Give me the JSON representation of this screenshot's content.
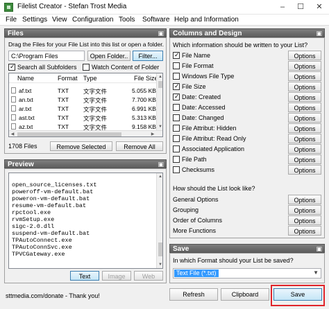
{
  "window": {
    "title": "Filelist Creator - Stefan Trost Media",
    "controls": {
      "minimize": "–",
      "maximize": "☐",
      "close": "✕"
    }
  },
  "menu": [
    "File",
    "Settings",
    "View",
    "Configuration",
    "Tools",
    "Software",
    "Help and Information"
  ],
  "files_panel": {
    "title": "Files",
    "instruction": "Drag the Files for your File List into this list or open a folder.",
    "path_value": "C:\\Program Files",
    "open_folder_label": "Open Folder..",
    "filter_label": "Filter...",
    "search_subfolders_label": "Search all Subfolders",
    "search_subfolders_checked": true,
    "watch_content_label": "Watch Content of Folder",
    "watch_content_checked": false,
    "columns": [
      "Name",
      "Format",
      "Type",
      "File Size"
    ],
    "rows": [
      [
        "af.txt",
        "TXT",
        "文字文件",
        "5.055 KB"
      ],
      [
        "an.txt",
        "TXT",
        "文字文件",
        "7.700 KB"
      ],
      [
        "ar.txt",
        "TXT",
        "文字文件",
        "6.991 KB"
      ],
      [
        "ast.txt",
        "TXT",
        "文字文件",
        "5.313 KB"
      ],
      [
        "az.txt",
        "TXT",
        "文字文件",
        "9.158 KB"
      ]
    ],
    "count_label": "1708 Files",
    "remove_selected_label": "Remove Selected",
    "remove_all_label": "Remove All"
  },
  "preview_panel": {
    "title": "Preview",
    "lines": [
      "open_source_licenses.txt",
      "poweroff-vm-default.bat",
      "poweron-vm-default.bat",
      "resume-vm-default.bat",
      "rpctool.exe",
      "rvmSetup.exe",
      "sigc-2.0.dll",
      "suspend-vm-default.bat",
      "TPAutoConnect.exe",
      "TPAutoConnSvc.exe",
      "TPVCGateway.exe"
    ],
    "text_label": "Text",
    "image_label": "Image",
    "web_label": "Web"
  },
  "columns_panel": {
    "title": "Columns and Design",
    "question": "Which information should be written to your List?",
    "option_label": "Options",
    "items": [
      {
        "label": "File Name",
        "checked": true
      },
      {
        "label": "File Format",
        "checked": false
      },
      {
        "label": "Windows File Type",
        "checked": false
      },
      {
        "label": "File Size",
        "checked": true
      },
      {
        "label": "Date: Created",
        "checked": true
      },
      {
        "label": "Date: Accessed",
        "checked": false
      },
      {
        "label": "Date: Changed",
        "checked": false
      },
      {
        "label": "File Attribut: Hidden",
        "checked": false
      },
      {
        "label": "File Attribut: Read Only",
        "checked": false
      },
      {
        "label": "Associated Application",
        "checked": false
      },
      {
        "label": "File Path",
        "checked": false
      },
      {
        "label": "Checksums",
        "checked": false
      }
    ],
    "look_question": "How should the List look like?",
    "look_items": [
      "General Options",
      "Grouping",
      "Order of Columns",
      "More Functions"
    ]
  },
  "save_panel": {
    "title": "Save",
    "question": "In which Format should your List be saved?",
    "format_value": "Text File (*.txt)"
  },
  "status": {
    "donate_text": "sttmedia.com/donate - Thank you!",
    "refresh_label": "Refresh",
    "clipboard_label": "Clipboard",
    "save_label": "Save"
  },
  "colors": {
    "highlight": "#e0242a",
    "selection": "#3399ff",
    "panel_header": "#6b6b6b"
  }
}
